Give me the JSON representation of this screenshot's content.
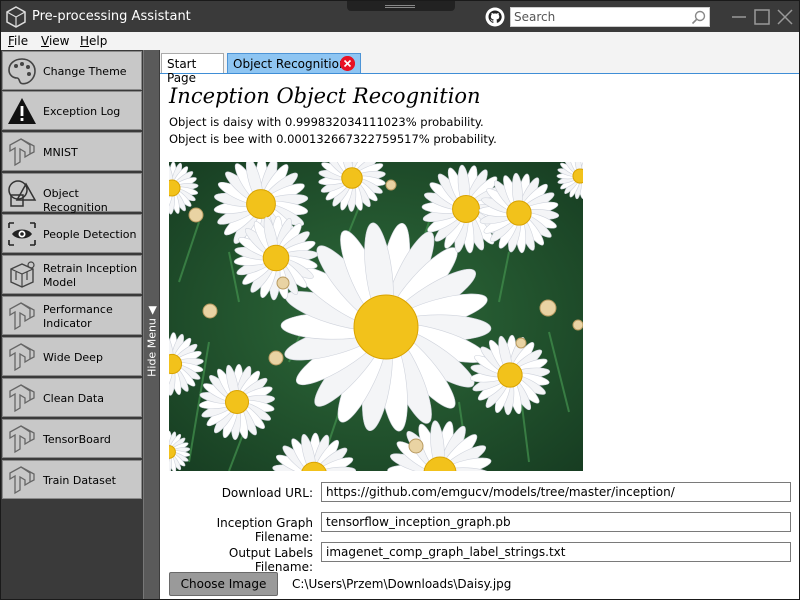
{
  "window": {
    "title": "Pre-processing Assistant"
  },
  "search": {
    "placeholder": "Search"
  },
  "menu": {
    "items": [
      {
        "accel": "F",
        "rest": "ile"
      },
      {
        "accel": "V",
        "rest": "iew"
      },
      {
        "accel": "H",
        "rest": "elp"
      }
    ]
  },
  "sidebar": {
    "toggle_label": "Hide Menu",
    "items": [
      {
        "label": "Change Theme",
        "icon": "palette-icon"
      },
      {
        "label": "Exception Log",
        "icon": "warning-icon"
      },
      {
        "label": "MNIST",
        "icon": "tensorflow-icon"
      },
      {
        "label": "Object Recognition",
        "icon": "shapes-icon"
      },
      {
        "label": "People Detection",
        "icon": "eye-icon"
      },
      {
        "label": "Retrain Inception Model",
        "icon": "retrain-icon"
      },
      {
        "label": "Performance Indicator",
        "icon": "tensorflow-icon"
      },
      {
        "label": "Wide Deep",
        "icon": "tensorflow-icon"
      },
      {
        "label": "Clean Data",
        "icon": "tensorflow-icon"
      },
      {
        "label": "TensorBoard",
        "icon": "tensorflow-icon"
      },
      {
        "label": "Train Dataset",
        "icon": "tensorflow-icon"
      }
    ]
  },
  "tabs": [
    {
      "label": "Start Page",
      "active": false
    },
    {
      "label": "Object Recognition",
      "active": true
    }
  ],
  "main": {
    "title": "Inception Object Recognition",
    "results": [
      "Object is daisy with 0.999832034111023% probability.",
      "Object is bee with 0.000132667322759517% probability."
    ],
    "form": {
      "download_url_label": "Download URL:",
      "download_url_value": "https://github.com/emgucv/models/tree/master/inception/",
      "graph_label": "Inception Graph Filename:",
      "graph_value": "tensorflow_inception_graph.pb",
      "labels_label": "Output Labels Filename:",
      "labels_value": "imagenet_comp_graph_label_strings.txt"
    },
    "choose_button": "Choose Image",
    "file_path": "C:\\Users\\Przem\\Downloads\\Daisy.jpg"
  },
  "colors": {
    "titlebar": "#3a3a3a",
    "sidebar_item": "#c8c8c8",
    "active_tab": "#8ec5f2",
    "tab_close": "#e81123"
  }
}
